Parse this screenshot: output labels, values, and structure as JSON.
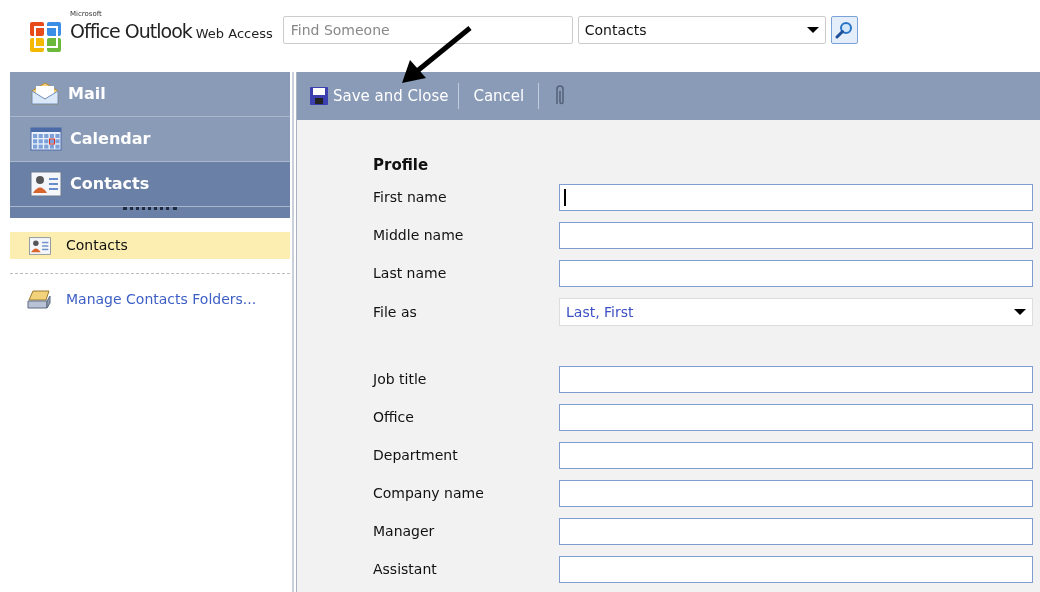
{
  "header": {
    "brand_small": "Microsoft",
    "brand_name": "Office Outlook",
    "brand_suffix": "Web Access",
    "search": {
      "placeholder": "Find Someone"
    },
    "scope": {
      "value": "Contacts"
    }
  },
  "nav": {
    "modules": [
      {
        "label": "Mail",
        "kind": "mail",
        "selected": false
      },
      {
        "label": "Calendar",
        "kind": "calendar",
        "selected": false
      },
      {
        "label": "Contacts",
        "kind": "contacts",
        "selected": true
      }
    ],
    "folders": [
      {
        "label": "Contacts",
        "selected": true
      }
    ],
    "links": [
      "Manage Contacts Folders..."
    ]
  },
  "toolbar": {
    "save": "Save and Close",
    "cancel": "Cancel"
  },
  "form": {
    "section": "Profile",
    "groups": [
      [
        {
          "label": "First name",
          "kind": "text",
          "focused": true
        },
        {
          "label": "Middle name",
          "kind": "text"
        },
        {
          "label": "Last name",
          "kind": "text"
        },
        {
          "label": "File as",
          "kind": "select",
          "value": "Last, First"
        }
      ],
      [
        {
          "label": "Job title",
          "kind": "text"
        },
        {
          "label": "Office",
          "kind": "text"
        },
        {
          "label": "Department",
          "kind": "text"
        },
        {
          "label": "Company name",
          "kind": "text"
        },
        {
          "label": "Manager",
          "kind": "text"
        },
        {
          "label": "Assistant",
          "kind": "text"
        }
      ]
    ]
  }
}
